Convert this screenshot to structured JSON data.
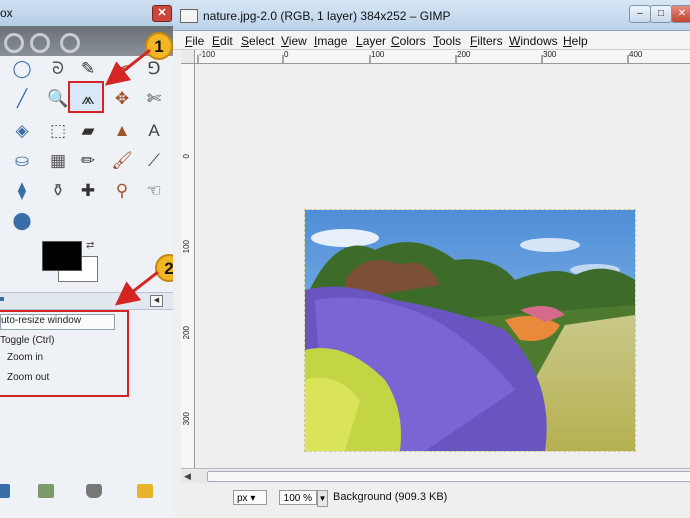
{
  "toolbox": {
    "title": "ox",
    "close_glyph": "✕",
    "tools": [
      {
        "name": "ellipse-select-icon",
        "glyph": "◯"
      },
      {
        "name": "free-select-icon",
        "glyph": "ᘐ"
      },
      {
        "name": "fuzzy-select-icon",
        "glyph": "✎"
      },
      {
        "name": "scissors-icon",
        "glyph": "✂"
      },
      {
        "name": "paths-icon",
        "glyph": "⅁"
      },
      {
        "name": "color-picker-icon",
        "glyph": "╱"
      },
      {
        "name": "zoom-icon",
        "glyph": "🔍"
      },
      {
        "name": "measure-icon",
        "glyph": "⩕"
      },
      {
        "name": "move-icon",
        "glyph": "✥"
      },
      {
        "name": "crop-icon",
        "glyph": "✄"
      },
      {
        "name": "rotate-icon",
        "glyph": "◈"
      },
      {
        "name": "scale-icon",
        "glyph": "⬚"
      },
      {
        "name": "shear-icon",
        "glyph": "▰"
      },
      {
        "name": "perspective-icon",
        "glyph": "▲"
      },
      {
        "name": "text-icon",
        "glyph": "A"
      },
      {
        "name": "bucket-fill-icon",
        "glyph": "⛀"
      },
      {
        "name": "blend-icon",
        "glyph": "▦"
      },
      {
        "name": "pencil-icon",
        "glyph": "✏"
      },
      {
        "name": "paintbrush-icon",
        "glyph": "🖌"
      },
      {
        "name": "eraser-icon",
        "glyph": "⟋"
      },
      {
        "name": "airbrush-icon",
        "glyph": "⧫"
      },
      {
        "name": "clone-icon",
        "glyph": "⚱"
      },
      {
        "name": "heal-icon",
        "glyph": "✚"
      },
      {
        "name": "perspective-clone-icon",
        "glyph": "⚲"
      },
      {
        "name": "smudge-icon",
        "glyph": "☜"
      },
      {
        "name": "dodge-burn-icon",
        "glyph": "⬤"
      }
    ]
  },
  "tool_options": {
    "auto_resize": "uto-resize window",
    "toggle": "Toggle  (Ctrl)",
    "zoom_in": "Zoom in",
    "zoom_out": "Zoom out"
  },
  "callouts": {
    "one": "1",
    "two": "2"
  },
  "image_window": {
    "title": "nature.jpg-2.0 (RGB, 1 layer) 384x252 – GIMP",
    "minimize": "–",
    "maximize": "□",
    "close": "✕",
    "menu": [
      {
        "label": "File",
        "u": "F",
        "rest": "ile"
      },
      {
        "label": "Edit",
        "u": "E",
        "rest": "dit"
      },
      {
        "label": "Select",
        "u": "S",
        "rest": "elect"
      },
      {
        "label": "View",
        "u": "V",
        "rest": "iew"
      },
      {
        "label": "Image",
        "u": "I",
        "rest": "mage"
      },
      {
        "label": "Layer",
        "u": "L",
        "rest": "ayer"
      },
      {
        "label": "Colors",
        "u": "C",
        "rest": "olors"
      },
      {
        "label": "Tools",
        "u": "T",
        "rest": "ools"
      },
      {
        "label": "Filters",
        "u": "F",
        "rest": "ilters"
      },
      {
        "label": "Windows",
        "u": "W",
        "rest": "indows"
      },
      {
        "label": "Help",
        "u": "H",
        "rest": "elp"
      }
    ],
    "ruler_h": [
      "-100",
      "0",
      "100",
      "200",
      "300",
      "400"
    ],
    "ruler_v": [
      "0",
      "100",
      "200",
      "300"
    ],
    "units": "px",
    "zoom": "100 %",
    "status": "Background (909.3 KB)"
  }
}
